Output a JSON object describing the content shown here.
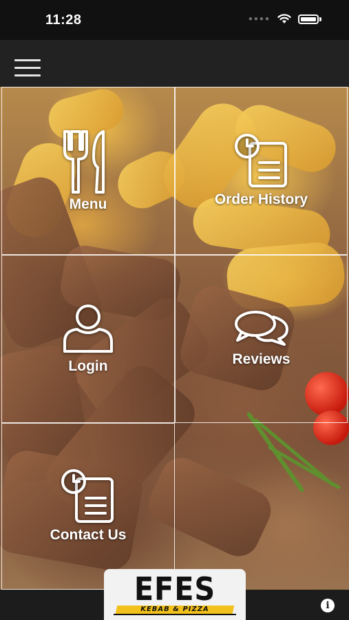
{
  "status_bar": {
    "time": "11:28"
  },
  "tiles": {
    "menu": "Menu",
    "order_history": "Order History",
    "login": "Login",
    "reviews": "Reviews",
    "contact_us": "Contact Us"
  },
  "footer": {
    "logo_title": "EFES",
    "logo_subtitle": "KEBAB & PIZZA",
    "info_glyph": "i"
  },
  "icons": {
    "menu": "cutlery-icon",
    "order_history": "clock-document-icon",
    "login": "user-icon",
    "reviews": "chat-bubbles-icon",
    "contact_us": "clock-document-icon",
    "nav": "hamburger-icon",
    "info": "info-icon"
  },
  "colors": {
    "nav_background": "#222222",
    "status_background": "#111111",
    "logo_accent": "#f3c11b"
  }
}
